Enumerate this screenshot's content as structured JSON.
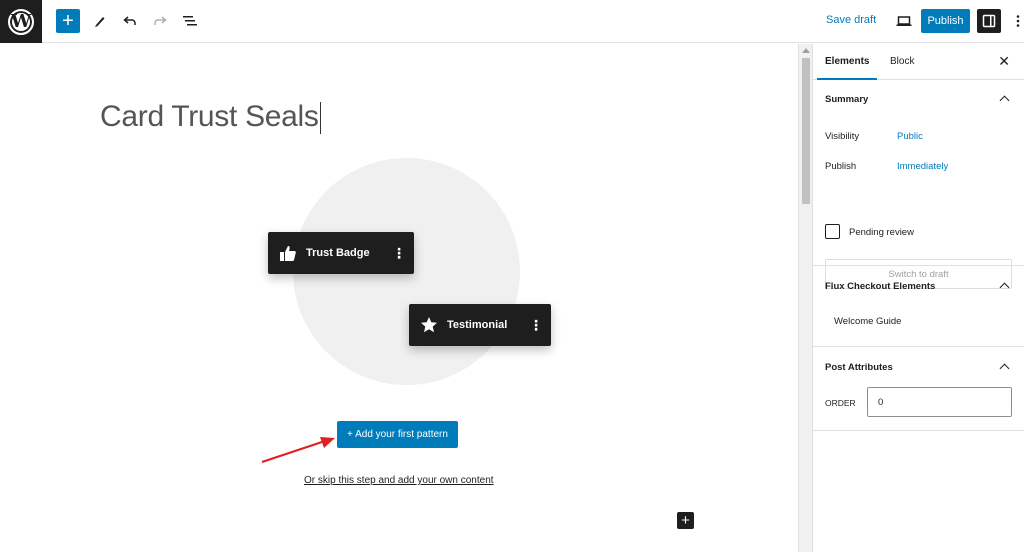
{
  "toolbar": {
    "add_icon": "plus-icon",
    "save_draft_label": "Save draft",
    "publish_label": "Publish"
  },
  "editor": {
    "post_title": "Card Trust Seals",
    "pattern_cards": [
      {
        "label": "Trust Badge",
        "icon": "thumbs-up-icon"
      },
      {
        "label": "Testimonial",
        "icon": "star-icon"
      }
    ],
    "add_pattern_label": "+ Add your first pattern",
    "skip_link_label": "Or skip this step and add your own content",
    "inserter_label": "+"
  },
  "sidebar": {
    "tabs": [
      {
        "label": "Elements",
        "active": true
      },
      {
        "label": "Block",
        "active": false
      }
    ],
    "summary": {
      "title": "Summary",
      "visibility_label": "Visibility",
      "visibility_value": "Public",
      "publish_label": "Publish",
      "publish_value": "Immediately",
      "pending_review_label": "Pending review",
      "pending_review_checked": false,
      "switch_to_draft_label": "Switch to draft"
    },
    "flux": {
      "title": "Flux Checkout Elements",
      "welcome_guide_label": "Welcome Guide"
    },
    "post_attributes": {
      "title": "Post Attributes",
      "order_label": "ORDER",
      "order_value": "0"
    }
  },
  "colors": {
    "accent": "#007cba",
    "dark": "#1e1e1e",
    "arrow": "#e02020"
  }
}
